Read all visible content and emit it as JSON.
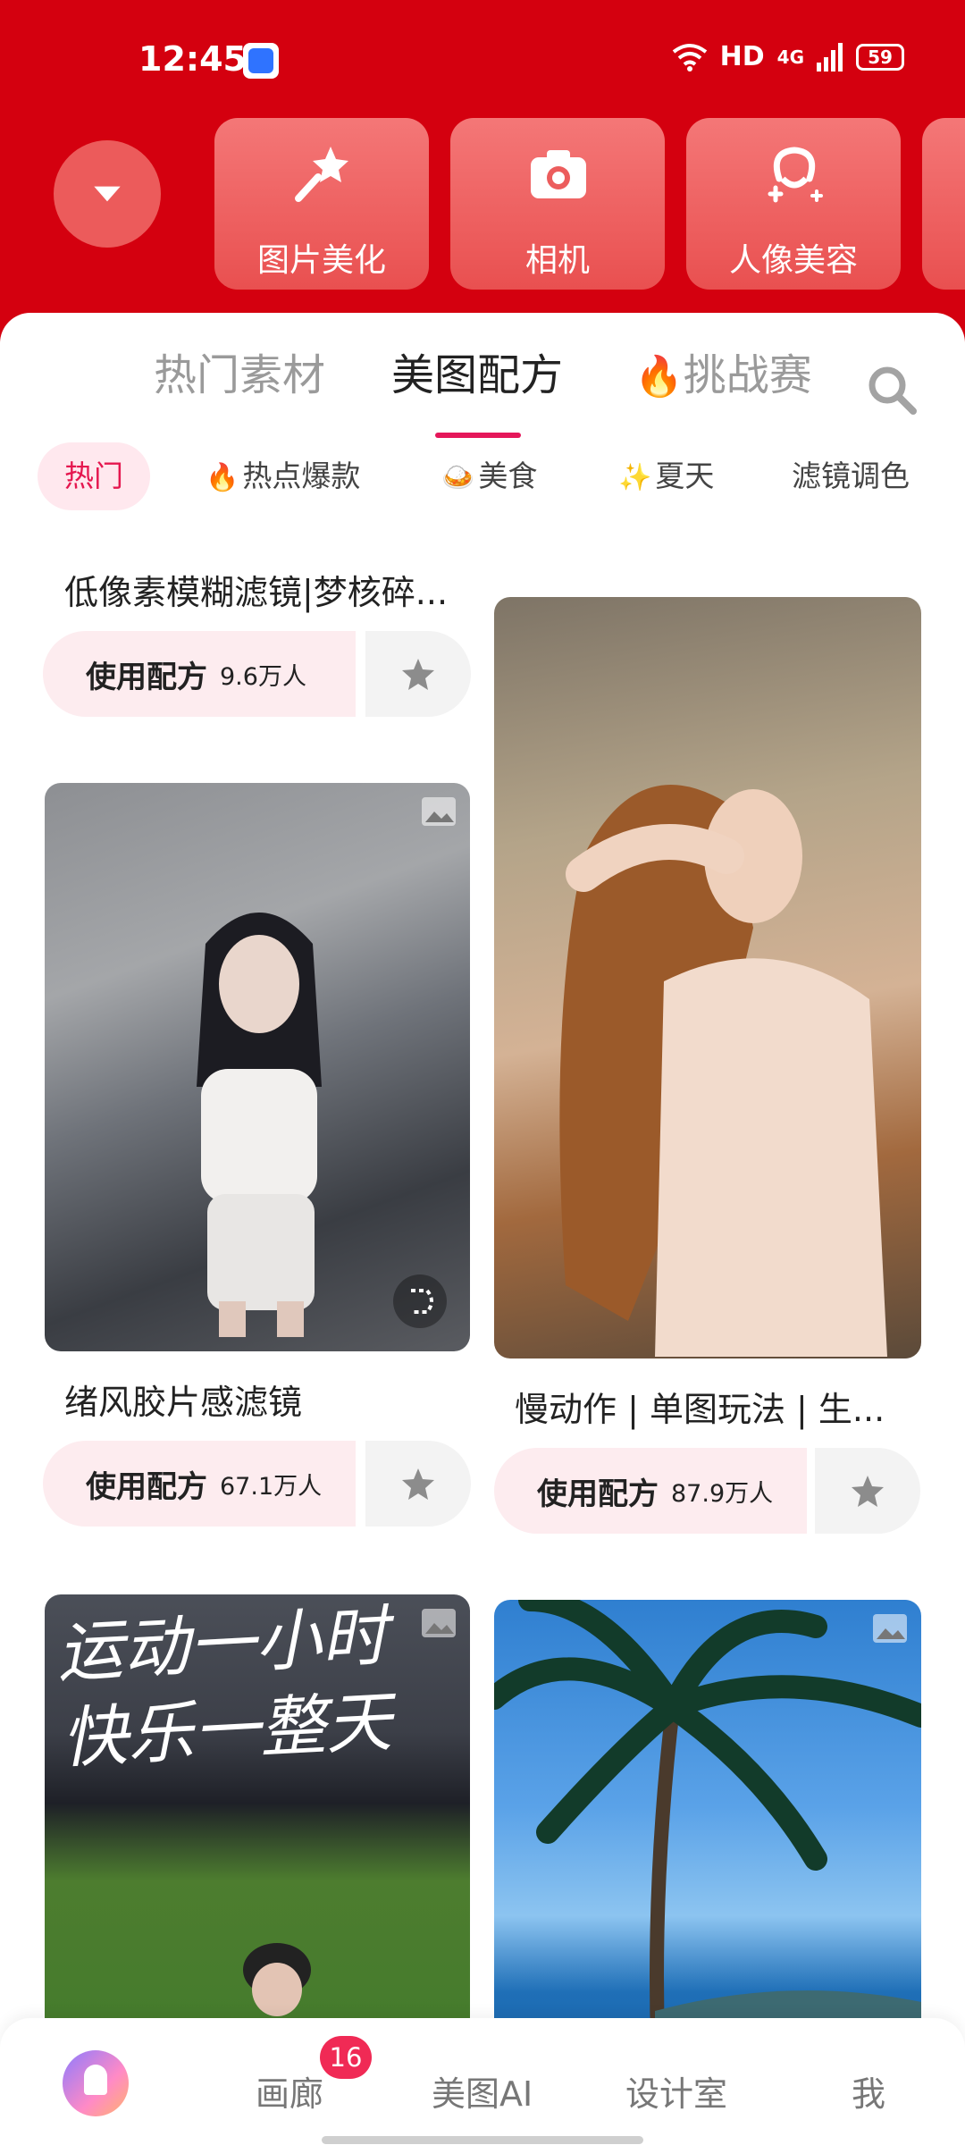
{
  "status_bar": {
    "time": "12:45",
    "network": "HD",
    "signal": "4G",
    "battery": "59"
  },
  "quick_actions": [
    {
      "label": "图片美化",
      "icon": "magic-wand-icon"
    },
    {
      "label": "相机",
      "icon": "camera-icon"
    },
    {
      "label": "人像美容",
      "icon": "face-icon"
    }
  ],
  "tabs": [
    {
      "label": "热门素材"
    },
    {
      "label": "美图配方"
    },
    {
      "label": "挑战赛"
    }
  ],
  "chips": [
    {
      "label": "热门",
      "emoji": ""
    },
    {
      "label": "热点爆款",
      "emoji": "🔥"
    },
    {
      "label": "美食",
      "emoji": "🍛"
    },
    {
      "label": "夏天",
      "emoji": "✨"
    },
    {
      "label": "滤镜调色",
      "emoji": ""
    }
  ],
  "feed": {
    "card1": {
      "title": "低像素模糊滤镜|梦核碎...",
      "use_label": "使用配方",
      "count": "9.6万人"
    },
    "card2": {
      "title": "绪风胶片感滤镜",
      "use_label": "使用配方",
      "count": "67.1万人"
    },
    "card3": {
      "title": "慢动作 | 单图玩法 | 生...",
      "use_label": "使用配方",
      "count": "87.9万人"
    },
    "card4": {
      "overlay_text_line1": "运动一小时",
      "overlay_text_line2": "快乐一整天"
    }
  },
  "bottom_nav": [
    {
      "label": "画廊",
      "badge": "16"
    },
    {
      "label": "美图AI"
    },
    {
      "label": "设计室"
    },
    {
      "label": "我"
    }
  ],
  "colors": {
    "brand_red": "#d4000f",
    "accent_pink": "#e5175a"
  }
}
